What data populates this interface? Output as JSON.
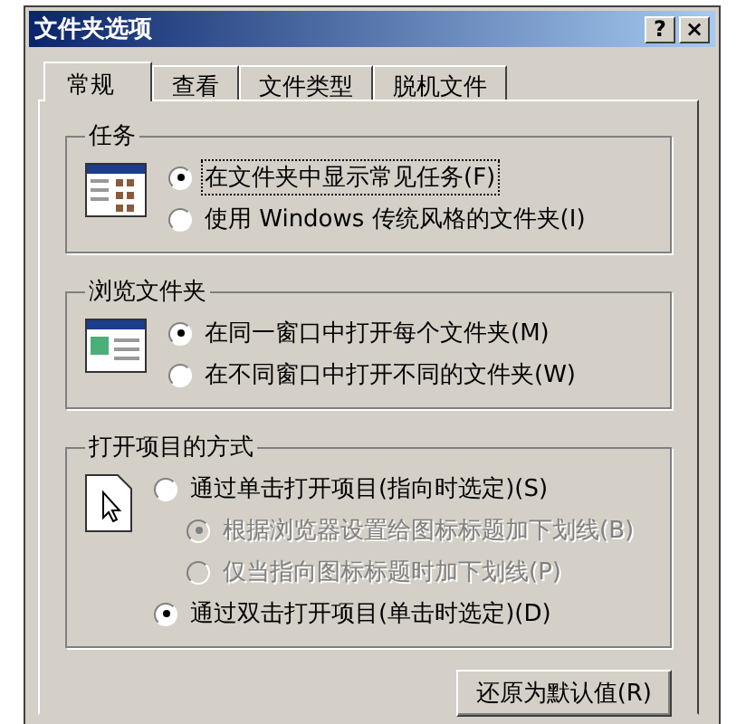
{
  "window": {
    "title": "文件夹选项",
    "help_button": "?",
    "close_button": "×"
  },
  "tabs": [
    {
      "label": "常规",
      "selected": true
    },
    {
      "label": "查看",
      "selected": false
    },
    {
      "label": "文件类型",
      "selected": false
    },
    {
      "label": "脱机文件",
      "selected": false
    }
  ],
  "groups": [
    {
      "title": "任务",
      "kind": "tasks",
      "options": [
        {
          "label": "在文件夹中显示常见任务(F)",
          "selected": true,
          "disabled": false,
          "focused": true
        },
        {
          "label": "使用 Windows 传统风格的文件夹(I)",
          "selected": false,
          "disabled": false,
          "focused": false
        }
      ]
    },
    {
      "title": "浏览文件夹",
      "kind": "browse",
      "options": [
        {
          "label": "在同一窗口中打开每个文件夹(M)",
          "selected": true,
          "disabled": false,
          "focused": false
        },
        {
          "label": "在不同窗口中打开不同的文件夹(W)",
          "selected": false,
          "disabled": false,
          "focused": false
        }
      ]
    },
    {
      "title": "打开项目的方式",
      "kind": "click",
      "options": [
        {
          "label": "通过单击打开项目(指向时选定)(S)",
          "selected": false,
          "disabled": false,
          "focused": false,
          "children": [
            {
              "label": "根据浏览器设置给图标标题加下划线(B)",
              "selected": true,
              "disabled": true,
              "focused": false
            },
            {
              "label": "仅当指向图标标题时加下划线(P)",
              "selected": false,
              "disabled": true,
              "focused": false
            }
          ]
        },
        {
          "label": "通过双击打开项目(单击时选定)(D)",
          "selected": true,
          "disabled": false,
          "focused": false
        }
      ]
    }
  ],
  "restore_button": "还原为默认值(R)"
}
